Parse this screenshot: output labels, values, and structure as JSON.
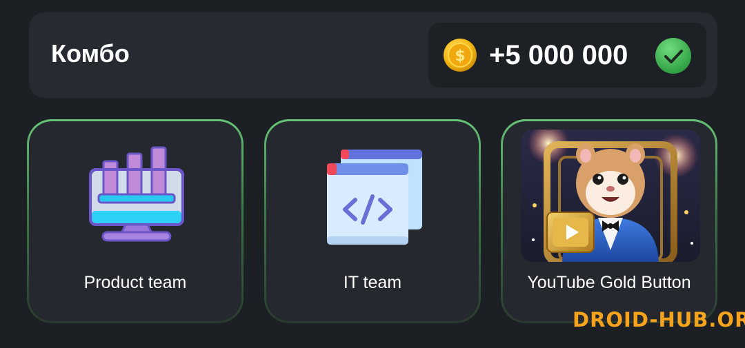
{
  "header": {
    "title": "Комбо",
    "reward_amount": "+5 000 000",
    "coin_icon": "gold-coin-icon",
    "status_icon": "checkmark-icon",
    "accent_color": "#3cab4f"
  },
  "cards": [
    {
      "label": "Product team",
      "icon": "product-dashboard-icon"
    },
    {
      "label": "IT team",
      "icon": "code-window-icon"
    },
    {
      "label": "YouTube Gold Button",
      "icon": "hamster-gold-button-image"
    }
  ],
  "watermark": "DROID-HUB.ORG"
}
